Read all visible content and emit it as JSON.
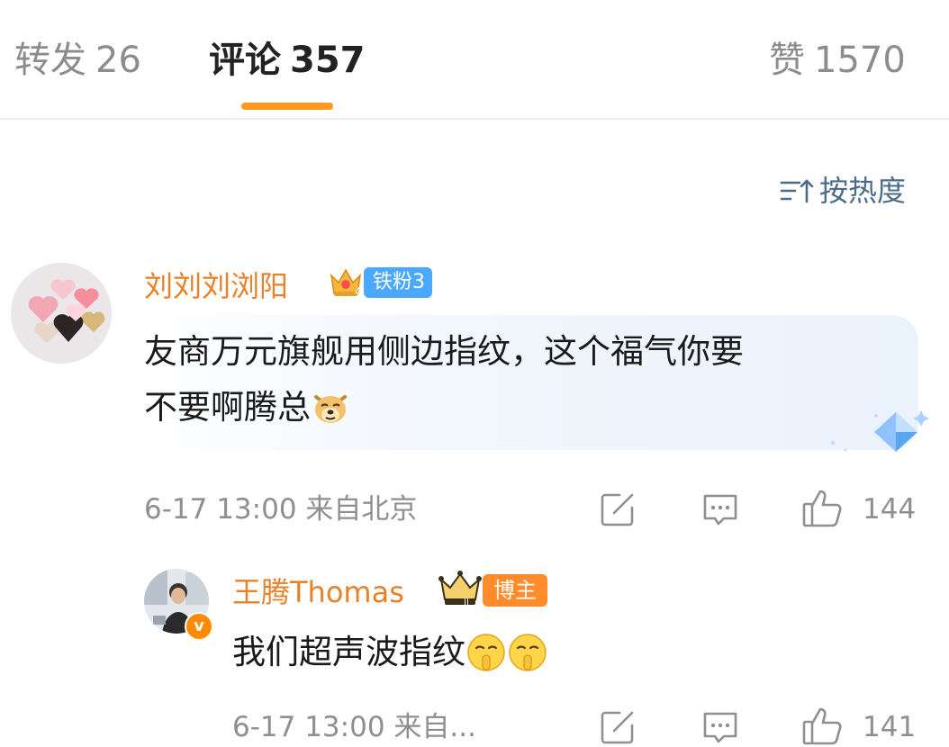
{
  "tabs": [
    {
      "label": "转发",
      "count": "26",
      "active": false
    },
    {
      "label": "评论",
      "count": "357",
      "active": true
    },
    {
      "label": "赞",
      "count": "1570",
      "active": false
    }
  ],
  "sort": {
    "label": "按热度",
    "icon": "sort-icon"
  },
  "comments": [
    {
      "username": "刘刘刘浏阳",
      "badge": "铁粉3",
      "text_line1": "友商万元旗舰用侧边指纹，这个福气你要",
      "text_line2": "不要啊腾总",
      "emoji": "doge-emoji",
      "meta": "6-17 13:00 来自北京",
      "likes": "144"
    },
    {
      "username": "王腾Thomas",
      "badge": "博主",
      "text": "我们超声波指纹",
      "emoji": "shush-face-emoji",
      "meta": "6-17 13:00 来自...",
      "likes": "141"
    }
  ],
  "colors": {
    "accent": "#ff9a1f",
    "username": "#e8822a",
    "fan_badge": "#4aa8ff",
    "host_badge": "#ff8b2a",
    "muted": "#8f8f8f",
    "sort": "#4a6b8a"
  }
}
